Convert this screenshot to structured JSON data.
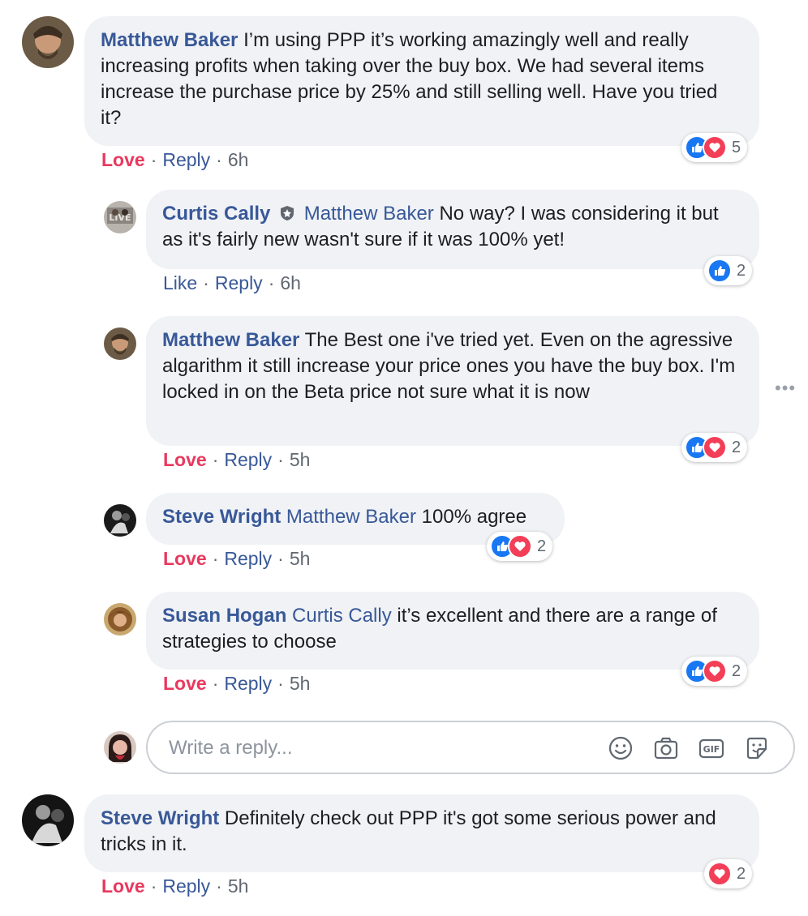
{
  "comments": [
    {
      "author": "Matthew Baker",
      "text": "I’m using PPP it’s working amazingly well and really increasing profits when taking over the buy box. We had several items increase the purchase price by 25% and still selling well. Have you tried it?",
      "action": "Love",
      "reply": "Reply",
      "time": "6h",
      "reactions": "5"
    },
    {
      "author": "Curtis Cally",
      "mention": "Matthew Baker",
      "text": "No way? I was considering it but as it's fairly new wasn't sure if it was 100% yet!",
      "action": "Like",
      "reply": "Reply",
      "time": "6h",
      "reactions": "2"
    },
    {
      "author": "Matthew Baker",
      "text": "The Best one i've tried yet. Even on the agressive algarithm it still increase your price ones you have the buy box. I'm locked in on the Beta price not sure what it is now",
      "action": "Love",
      "reply": "Reply",
      "time": "5h",
      "reactions": "2"
    },
    {
      "author": "Steve Wright",
      "mention": "Matthew Baker",
      "text": "100% agree",
      "action": "Love",
      "reply": "Reply",
      "time": "5h",
      "reactions": "2"
    },
    {
      "author": "Susan Hogan",
      "mention": "Curtis Cally",
      "text": "it’s excellent and there are a range of strategies to choose",
      "action": "Love",
      "reply": "Reply",
      "time": "5h",
      "reactions": "2"
    },
    {
      "author": "Steve Wright",
      "text": "Definitely check out PPP it's got some serious power and tricks in it.",
      "action": "Love",
      "reply": "Reply",
      "time": "5h",
      "reactions": "2"
    }
  ],
  "reply_box": {
    "placeholder": "Write a reply...",
    "icons": [
      "emoji-icon",
      "camera-icon",
      "gif-icon",
      "sticker-icon"
    ]
  },
  "colors": {
    "name": "#385898",
    "love": "#e9385e",
    "bubble": "#f0f2f5",
    "like_icon": "#1877f2",
    "love_icon": "#f33e58"
  }
}
